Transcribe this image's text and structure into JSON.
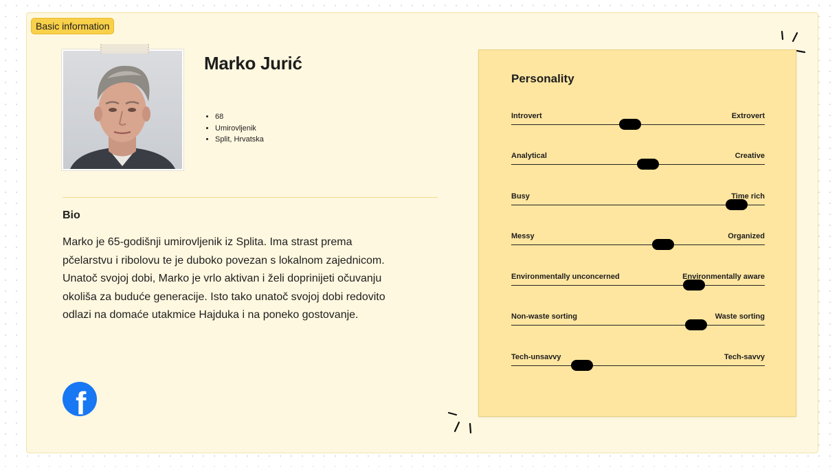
{
  "badge": "Basic information",
  "profile": {
    "name": "Marko Jurić",
    "facts": [
      "68",
      "Umirovljenik",
      "Split, Hrvatska"
    ]
  },
  "bio": {
    "title": "Bio",
    "lines": [
      "Marko je 65-godišnji umirovljenik iz Splita. Ima strast prema",
      "pčelarstvu i ribolovu te je duboko povezan s lokalnom zajednicom.",
      "Unatoč svojoj dobi, Marko je vrlo aktivan i želi doprinijeti očuvanju",
      "okoliša za buduće generacije. Isto tako unatoč svojoj dobi redovito",
      "odlazi na domaće utakmice Hajduka i na poneko gostovanje."
    ]
  },
  "social": {
    "icon": "facebook-icon"
  },
  "personality": {
    "title": "Personality",
    "traits": [
      {
        "left": "Introvert",
        "right": "Extrovert",
        "value": 0.47
      },
      {
        "left": "Analytical",
        "right": "Creative",
        "value": 0.54
      },
      {
        "left": "Busy",
        "right": "Time rich",
        "value": 0.89
      },
      {
        "left": "Messy",
        "right": "Organized",
        "value": 0.6
      },
      {
        "left": "Environmentally unconcerned",
        "right": "Environmentally aware",
        "value": 0.72
      },
      {
        "left": "Non-waste sorting",
        "right": "Waste sorting",
        "value": 0.73
      },
      {
        "left": "Tech-unsavvy",
        "right": "Tech-savvy",
        "value": 0.28
      }
    ]
  },
  "colors": {
    "card_bg": "#fff8e0",
    "sticky_bg": "#ffe6a0",
    "badge_bg": "#f9d04a",
    "facebook_blue": "#1877f2"
  }
}
